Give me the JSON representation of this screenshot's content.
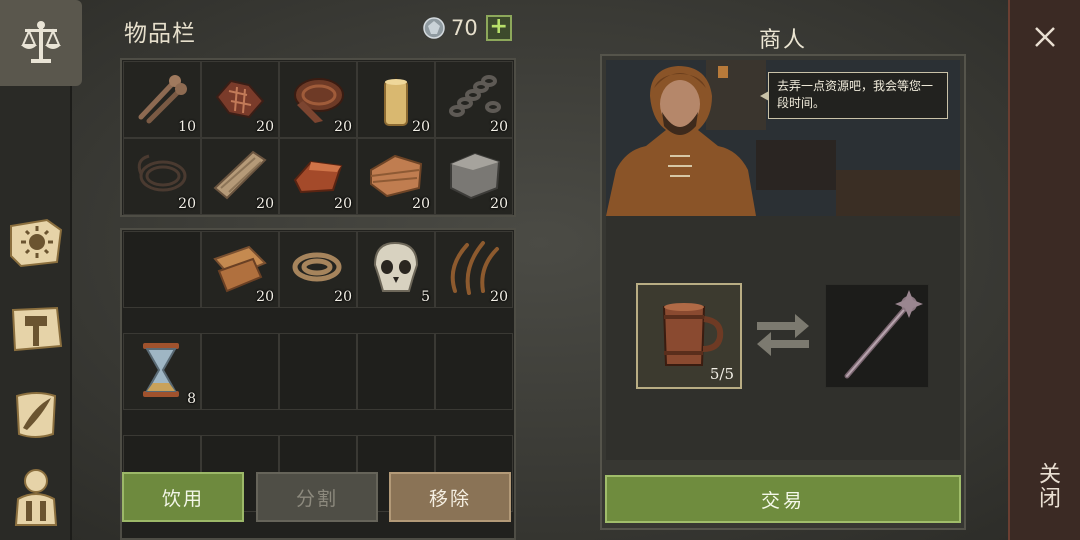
{
  "colors": {
    "accent_green": "#6f8c3e",
    "remove_brown": "#8a7356",
    "disabled_gray": "#4f4e46",
    "close_bar": "#3b2a24"
  },
  "rail": {
    "tabs": [
      {
        "icon": "scales-icon",
        "active": true
      },
      {
        "icon": "sun-book-icon",
        "active": false
      },
      {
        "icon": "hammer-map-icon",
        "active": false
      },
      {
        "icon": "quill-scroll-icon",
        "active": false
      },
      {
        "icon": "character-icon",
        "active": false
      }
    ]
  },
  "inventory": {
    "title": "物品栏",
    "currency": {
      "icon": "gem-coin-icon",
      "value": "70",
      "add_label": "+"
    },
    "grid_a": [
      {
        "icon": "nails-icon",
        "count": "10"
      },
      {
        "icon": "cloth-scraps-icon",
        "count": "20"
      },
      {
        "icon": "leather-roll-icon",
        "count": "20"
      },
      {
        "icon": "candle-icon",
        "count": "20"
      },
      {
        "icon": "chain-icon",
        "count": "20"
      },
      {
        "icon": "rope-coil-icon",
        "count": "20"
      },
      {
        "icon": "wood-planks-icon",
        "count": "20"
      },
      {
        "icon": "copper-ingot-icon",
        "count": "20"
      },
      {
        "icon": "folded-leather-icon",
        "count": "20"
      },
      {
        "icon": "stone-block-icon",
        "count": "20"
      }
    ],
    "grid_b": [
      {
        "icon": "",
        "count": ""
      },
      {
        "icon": "fabric-roll-icon",
        "count": "20"
      },
      {
        "icon": "hemp-rope-icon",
        "count": "20"
      },
      {
        "icon": "skull-icon",
        "count": "5"
      },
      {
        "icon": "fiber-strands-icon",
        "count": "20"
      },
      {
        "icon": "hourglass-icon",
        "count": "8"
      },
      {
        "icon": "",
        "count": ""
      },
      {
        "icon": "",
        "count": ""
      },
      {
        "icon": "",
        "count": ""
      },
      {
        "icon": "",
        "count": ""
      },
      {
        "icon": "",
        "count": ""
      },
      {
        "icon": "",
        "count": ""
      },
      {
        "icon": "",
        "count": ""
      },
      {
        "icon": "",
        "count": ""
      },
      {
        "icon": "",
        "count": ""
      }
    ],
    "buttons": {
      "use": "饮用",
      "split": "分割",
      "remove": "移除"
    }
  },
  "merchant": {
    "title": "商人",
    "speech": "去弄一点资源吧，我会等您一段时间。",
    "offer": {
      "icon": "tankard-icon",
      "count": "5/5"
    },
    "reward": {
      "icon": "mace-icon"
    },
    "trade_label": "交易"
  },
  "close": {
    "label": "关闭"
  }
}
